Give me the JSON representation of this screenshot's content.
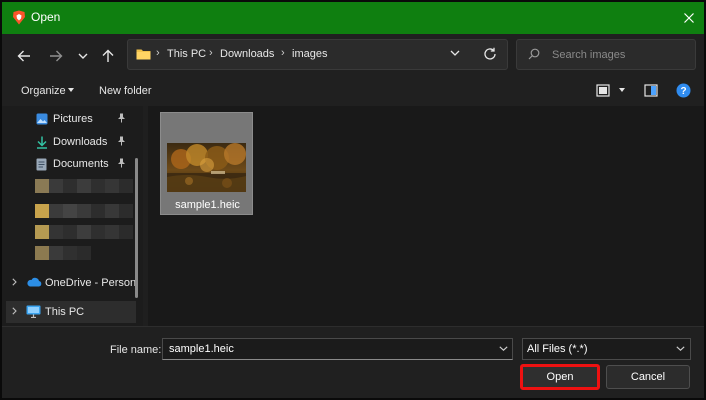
{
  "window": {
    "title": "Open",
    "accent": "#0f7f10"
  },
  "breadcrumb": {
    "items": [
      "This PC",
      "Downloads",
      "images"
    ]
  },
  "search": {
    "placeholder": "Search images"
  },
  "toolbar": {
    "organize_label": "Organize",
    "new_folder_label": "New folder"
  },
  "sidebar": {
    "quick_access": [
      {
        "label": "Pictures",
        "icon": "pictures-icon",
        "pinned": true
      },
      {
        "label": "Downloads",
        "icon": "downloads-icon",
        "pinned": true
      },
      {
        "label": "Documents",
        "icon": "documents-icon",
        "pinned": true
      }
    ],
    "tree": [
      {
        "label": "OneDrive - Person",
        "icon": "onedrive-icon"
      },
      {
        "label": "This PC",
        "icon": "this-pc-icon"
      }
    ]
  },
  "files": [
    {
      "name": "sample1.heic",
      "selected": true
    }
  ],
  "footer": {
    "file_name_label": "File name:",
    "file_name_value": "sample1.heic",
    "file_type_value": "All Files (*.*)",
    "open_label": "Open",
    "cancel_label": "Cancel"
  }
}
